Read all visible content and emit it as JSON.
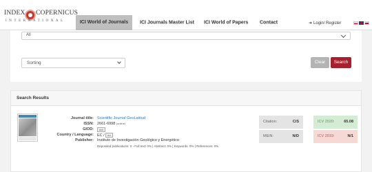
{
  "header": {
    "logo": {
      "word1": "INDEX",
      "word2": "COPERNICUS",
      "sub": "INTERNATIONAL"
    },
    "nav": [
      {
        "label": "ICI World of Journals",
        "active": true
      },
      {
        "label": "ICI Journals Master List",
        "active": false
      },
      {
        "label": "ICI World of Papers",
        "active": false
      },
      {
        "label": "Contact",
        "active": false
      }
    ],
    "login": "Login/ Register",
    "login_icon": "sign-in-icon",
    "flags": [
      "pl-flag-icon",
      "gb-flag-icon",
      "ru-flag-icon"
    ]
  },
  "filters": {
    "select_all_value": "All",
    "sorting_value": "Sorting",
    "clear_label": "Clear",
    "search_label": "Search"
  },
  "results": {
    "heading": "Search Results",
    "item": {
      "labels": {
        "title": "Journal title:",
        "issn": "ISSN:",
        "giod": "GIOD:",
        "country": "Country / Language:",
        "publisher": "Publisher:"
      },
      "title": "Scientific Journal GeoLatitud",
      "issn": "2661-6998",
      "issn_note": "(online)",
      "giod": "not",
      "country": "EC /",
      "language_tag": "en",
      "publisher": "Instituto de Investigación Geológico y Energético",
      "deposited": "Deposited publications: 0 › Full text: 0% | Abstract: 0% | Keywords: 0% | References: 0%",
      "metrics": {
        "citation_label": "Citation:",
        "citation_value": "C/S",
        "mein_label": "MEiN:",
        "mein_value": "N/D",
        "icv2020_label": "ICV 2020:",
        "icv2020_value": "65.08",
        "icv2019_label": "ICV 2019:",
        "icv2019_value": "N/1"
      }
    }
  },
  "colors": {
    "accent": "#a8202e",
    "link": "#2a76c5",
    "icv_good_bg": "#d4ecd3",
    "icv_bad_bg": "#f6d9d5"
  }
}
